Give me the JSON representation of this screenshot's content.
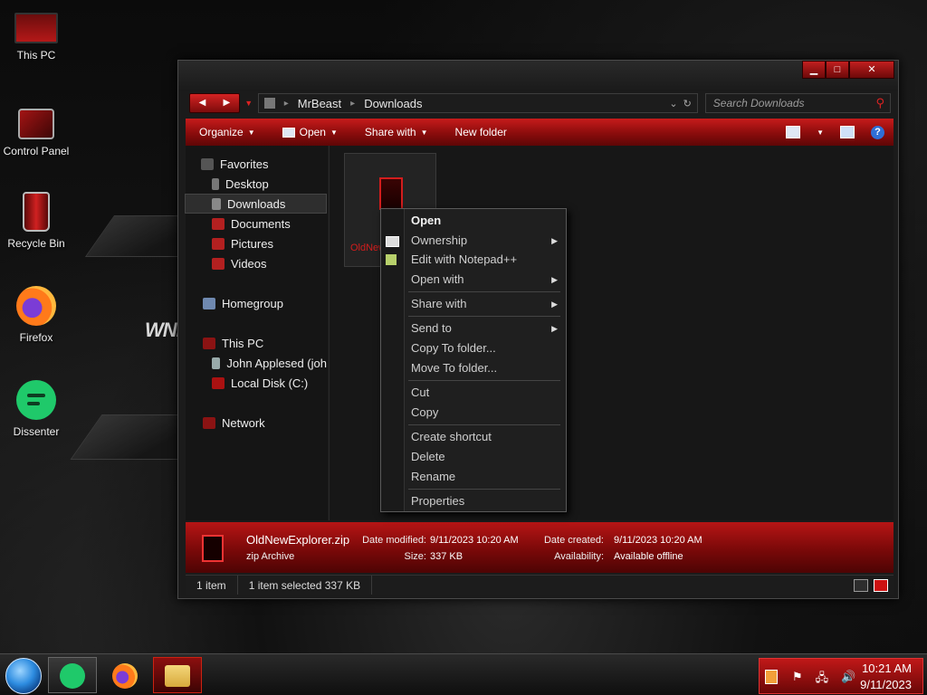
{
  "desktop": {
    "icons": [
      {
        "label": "This PC"
      },
      {
        "label": "Control Panel"
      },
      {
        "label": "Recycle Bin"
      },
      {
        "label": "Firefox"
      },
      {
        "label": "Dissenter"
      }
    ],
    "wallpaper_text": "WND"
  },
  "window": {
    "caption": {
      "minimize": "▁",
      "maximize": "□",
      "close": "✕"
    },
    "nav": {
      "back": "◀",
      "forward": "▶",
      "recent": "▼"
    },
    "address": {
      "crumbs": [
        "MrBeast",
        "Downloads"
      ],
      "separator": "▸",
      "dropdown": "⌄",
      "refresh": "↻"
    },
    "search": {
      "placeholder": "Search Downloads",
      "icon": "⚲"
    },
    "toolbar": {
      "organize": "Organize",
      "open": "Open",
      "share_with": "Share with",
      "new_folder": "New folder",
      "caret": "▼",
      "help": "?"
    },
    "navpane": {
      "favorites": "Favorites",
      "desktop": "Desktop",
      "downloads": "Downloads",
      "documents": "Documents",
      "pictures": "Pictures",
      "videos": "Videos",
      "homegroup": "Homegroup",
      "this_pc": "This PC",
      "user": "John Applesed (joh",
      "local_disk": "Local Disk (C:)",
      "network": "Network"
    },
    "file": {
      "label": "OldNew"
    },
    "details": {
      "name": "OldNewExplorer.zip",
      "type": "zip Archive",
      "date_modified_label": "Date modified:",
      "date_modified": "9/11/2023 10:20 AM",
      "size_label": "Size:",
      "size": "337 KB",
      "date_created_label": "Date created:",
      "date_created": "9/11/2023 10:20 AM",
      "availability_label": "Availability:",
      "availability": "Available offline"
    },
    "status": {
      "count": "1 item",
      "selected": "1 item selected  337 KB"
    }
  },
  "context_menu": {
    "arrow": "▶",
    "items": {
      "open": "Open",
      "ownership": "Ownership",
      "edit_notepad": "Edit with Notepad++",
      "open_with": "Open with",
      "share_with": "Share with",
      "send_to": "Send to",
      "copy_to": "Copy To folder...",
      "move_to": "Move To folder...",
      "cut": "Cut",
      "copy": "Copy",
      "create_shortcut": "Create shortcut",
      "delete": "Delete",
      "rename": "Rename",
      "properties": "Properties"
    }
  },
  "taskbar": {
    "tray_icons": [
      "⚑",
      "🖧",
      "🔊"
    ],
    "time": "10:21 AM",
    "date": "9/11/2023"
  },
  "colors": {
    "accent": "#c41a1a",
    "dark": "#171717",
    "dissenter": "#1fc96a"
  }
}
